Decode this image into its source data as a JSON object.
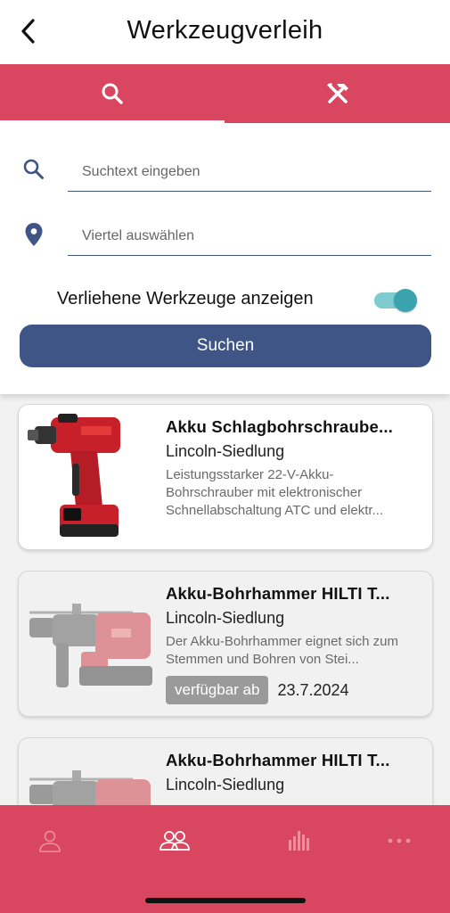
{
  "header": {
    "title": "Werkzeugverleih"
  },
  "tabs": [
    {
      "icon": "search-icon",
      "active": true
    },
    {
      "icon": "tools-icon",
      "active": false
    }
  ],
  "search": {
    "text_placeholder": "Suchtext eingeben",
    "district_placeholder": "Viertel auswählen",
    "toggle_label": "Verliehene Werkzeuge anzeigen",
    "toggle_on": true,
    "button_label": "Suchen"
  },
  "results": [
    {
      "title": "Akku Schlagbohrschraube...",
      "district": "Lincoln-Siedlung",
      "description": "Leistungsstarker 22-V-Akku-Bohrschrauber mit elektronischer Schnellabschaltung ATC und elektr...",
      "available": true
    },
    {
      "title": "Akku-Bohrhammer HILTI T...",
      "district": "Lincoln-Siedlung",
      "description": "Der Akku-Bohrhammer eignet sich zum Stemmen und Bohren von Stei...",
      "available": false,
      "available_from_label": "verfügbar ab",
      "available_from_date": "23.7.2024"
    },
    {
      "title": "Akku-Bohrhammer HILTI T...",
      "district": "Lincoln-Siedlung",
      "available": false
    }
  ],
  "bottom_nav": [
    {
      "icon": "person-icon",
      "active": false
    },
    {
      "icon": "group-icon",
      "active": true
    },
    {
      "icon": "bar-chart-icon",
      "active": false
    },
    {
      "icon": "more-icon",
      "active": false
    }
  ],
  "colors": {
    "accent": "#d8465f",
    "primary": "#3f5585",
    "toggle": "#3aa3ae"
  }
}
